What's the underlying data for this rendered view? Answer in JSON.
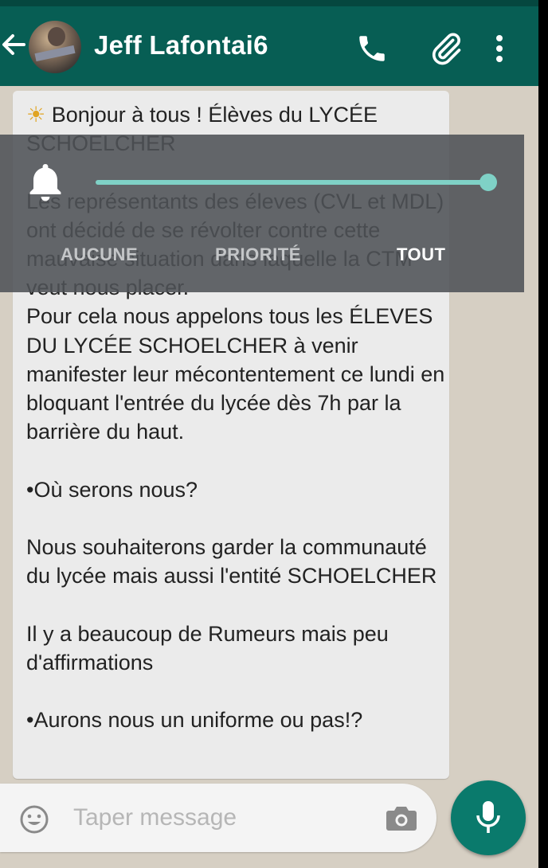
{
  "header": {
    "contact_name": "Jeff Lafontai6",
    "icons": [
      "back-arrow-icon",
      "avatar",
      "phone-icon",
      "paperclip-icon",
      "more-vert-icon"
    ]
  },
  "message": {
    "text": "Bonjour à tous ! Élèves du LYCÉE SCHOELCHER \n\nLes représentants des éleves (CVL et MDL) ont décidé de se révolter contre cette mauvaise situation dans laquelle la CTM veut nous placer.\nPour cela nous appelons tous les ÉLEVES DU LYCÉE SCHOELCHER à venir manifester leur mécontentement ce lundi en bloquant l'entrée du lycée dès 7h par la barrière du haut.\n\n•Où serons nous?\n\nNous souhaiterons garder la communauté du lycée mais aussi l'entité SCHOELCHER\n\nIl y a beaucoup de Rumeurs mais peu d'affirmations\n\n•Aurons nous un uniforme ou pas!?",
    "lead_emoji": "☀",
    "trail_emoji": "☀"
  },
  "notification_panel": {
    "level": 1.0,
    "options": {
      "none": "AUCUNE",
      "priority": "PRIORITÉ",
      "all": "TOUT"
    },
    "selected": "all",
    "accent_color": "#7fd1c6"
  },
  "composer": {
    "placeholder": "Taper message",
    "value": ""
  },
  "colors": {
    "header": "#075e54",
    "mic_button": "#0a7a6c",
    "bubble": "#ebebeb"
  }
}
